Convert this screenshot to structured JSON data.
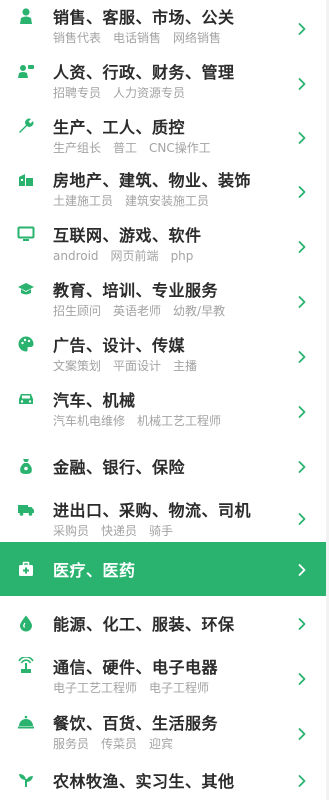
{
  "colors": {
    "accent": "#29b36f",
    "title": "#2b2b2b",
    "sub": "#a3a3a3"
  },
  "categories": [
    {
      "icon": "person-icon",
      "title": "销售、客服、市场、公关",
      "subs": [
        "销售代表",
        "电话销售",
        "网络销售"
      ]
    },
    {
      "icon": "people-icon",
      "title": "人资、行政、财务、管理",
      "subs": [
        "招聘专员",
        "人力资源专员"
      ]
    },
    {
      "icon": "wrench-icon",
      "title": "生产、工人、质控",
      "subs": [
        "生产组长",
        "普工",
        "CNC操作工"
      ]
    },
    {
      "icon": "building-icon",
      "title": "房地产、建筑、物业、装饰",
      "subs": [
        "土建施工员",
        "建筑安装施工员"
      ]
    },
    {
      "icon": "monitor-icon",
      "title": "互联网、游戏、软件",
      "subs": [
        "android",
        "网页前端",
        "php"
      ]
    },
    {
      "icon": "graduation-cap-icon",
      "title": "教育、培训、专业服务",
      "subs": [
        "招生顾问",
        "英语老师",
        "幼教/早教"
      ]
    },
    {
      "icon": "palette-icon",
      "title": "广告、设计、传媒",
      "subs": [
        "文案策划",
        "平面设计",
        "主播"
      ]
    },
    {
      "icon": "car-icon",
      "title": "汽车、机械",
      "subs": [
        "汽车机电维修",
        "机械工艺工程师"
      ]
    },
    {
      "icon": "money-bag-icon",
      "title": "金融、银行、保险",
      "subs": []
    },
    {
      "icon": "truck-icon",
      "title": "进出口、采购、物流、司机",
      "subs": [
        "采购员",
        "快递员",
        "骑手"
      ]
    },
    {
      "icon": "medical-kit-icon",
      "title": "医疗、医药",
      "subs": [],
      "active": true
    },
    {
      "icon": "drop-icon",
      "title": "能源、化工、服装、环保",
      "subs": []
    },
    {
      "icon": "antenna-icon",
      "title": "通信、硬件、电子电器",
      "subs": [
        "电子工艺工程师",
        "电子工程师"
      ]
    },
    {
      "icon": "cloche-icon",
      "title": "餐饮、百货、生活服务",
      "subs": [
        "服务员",
        "传菜员",
        "迎宾"
      ]
    },
    {
      "icon": "plant-icon",
      "title": "农林牧渔、实习生、其他",
      "subs": []
    }
  ]
}
